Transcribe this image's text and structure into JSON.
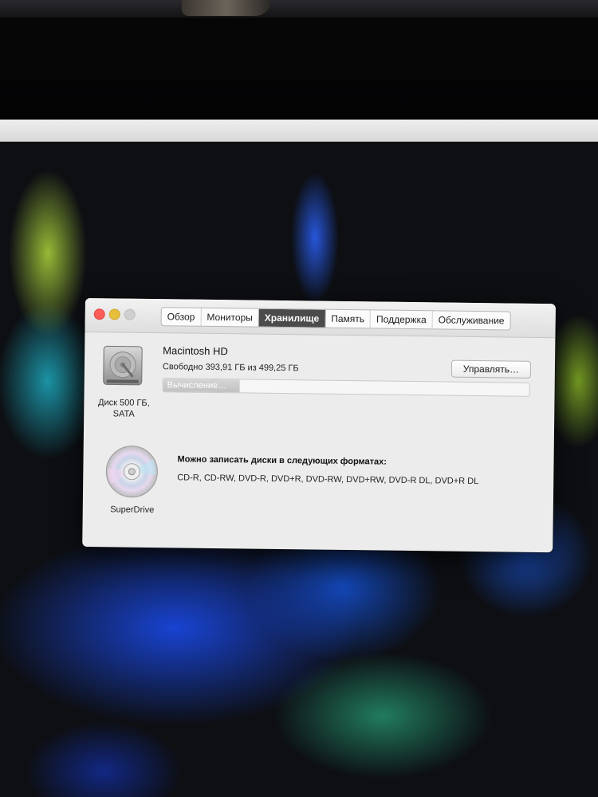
{
  "tabs": [
    {
      "label": "Обзор",
      "active": false
    },
    {
      "label": "Мониторы",
      "active": false
    },
    {
      "label": "Хранилище",
      "active": true
    },
    {
      "label": "Память",
      "active": false
    },
    {
      "label": "Поддержка",
      "active": false
    },
    {
      "label": "Обслуживание",
      "active": false
    }
  ],
  "disk": {
    "icon": "hard-drive-icon",
    "caption_line1": "Диск 500 ГБ,",
    "caption_line2": "SATA",
    "volume_name": "Macintosh HD",
    "free_text": "Свободно 393,91 ГБ из 499,25 ГБ",
    "manage_label": "Управлять…",
    "usage_label": "Вычисление…",
    "usage_fraction": 0.21
  },
  "drive": {
    "icon": "optical-disc-icon",
    "caption": "SuperDrive",
    "formats_heading": "Можно записать диски в следующих форматах:",
    "formats_list": "CD-R, CD-RW, DVD-R, DVD+R, DVD-RW, DVD+RW, DVD-R DL, DVD+R DL"
  },
  "colors": {
    "close": "#fc5b57",
    "minimize": "#e5bf3c",
    "active_tab": "#4b4b4b"
  }
}
